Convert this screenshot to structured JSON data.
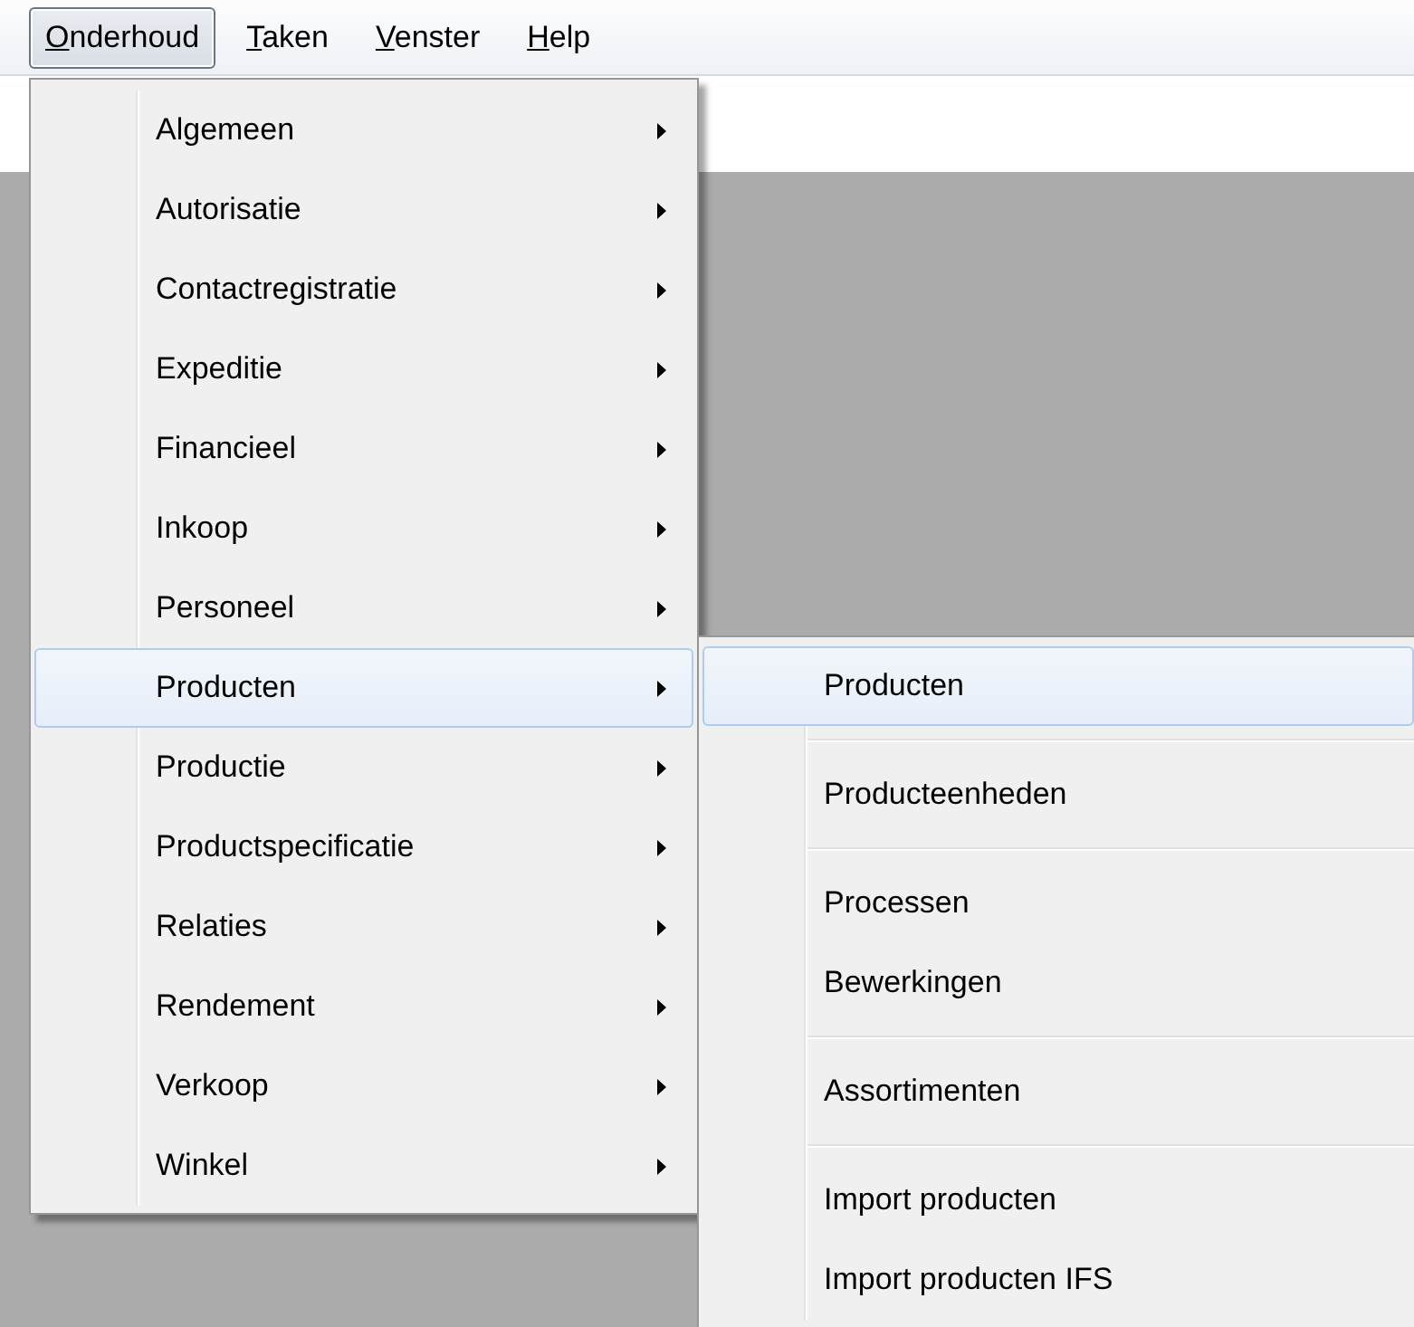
{
  "menubar": [
    {
      "label": "Onderhoud",
      "selected": true
    },
    {
      "label": "Taken",
      "selected": false
    },
    {
      "label": "Venster",
      "selected": false
    },
    {
      "label": "Help",
      "selected": false
    }
  ],
  "menu": {
    "items": [
      {
        "label": "Algemeen",
        "has_submenu": true,
        "selected": false
      },
      {
        "label": "Autorisatie",
        "has_submenu": true,
        "selected": false
      },
      {
        "label": "Contactregistratie",
        "has_submenu": true,
        "selected": false
      },
      {
        "label": "Expeditie",
        "has_submenu": true,
        "selected": false
      },
      {
        "label": "Financieel",
        "has_submenu": true,
        "selected": false
      },
      {
        "label": "Inkoop",
        "has_submenu": true,
        "selected": false
      },
      {
        "label": "Personeel",
        "has_submenu": true,
        "selected": false
      },
      {
        "label": "Producten",
        "has_submenu": true,
        "selected": true
      },
      {
        "label": "Productie",
        "has_submenu": true,
        "selected": false
      },
      {
        "label": "Productspecificatie",
        "has_submenu": true,
        "selected": false
      },
      {
        "label": "Relaties",
        "has_submenu": true,
        "selected": false
      },
      {
        "label": "Rendement",
        "has_submenu": true,
        "selected": false
      },
      {
        "label": "Verkoop",
        "has_submenu": true,
        "selected": false
      },
      {
        "label": "Winkel",
        "has_submenu": true,
        "selected": false
      }
    ]
  },
  "submenu": {
    "items": [
      {
        "label": "Producten",
        "selected": true,
        "separator_after": true
      },
      {
        "label": "Producteenheden",
        "selected": false,
        "separator_after": true
      },
      {
        "label": "Processen",
        "selected": false,
        "separator_after": false
      },
      {
        "label": "Bewerkingen",
        "selected": false,
        "separator_after": true
      },
      {
        "label": "Assortimenten",
        "selected": false,
        "separator_after": true
      },
      {
        "label": "Import producten",
        "selected": false,
        "separator_after": false
      },
      {
        "label": "Import producten IFS",
        "selected": false,
        "separator_after": false
      }
    ]
  }
}
